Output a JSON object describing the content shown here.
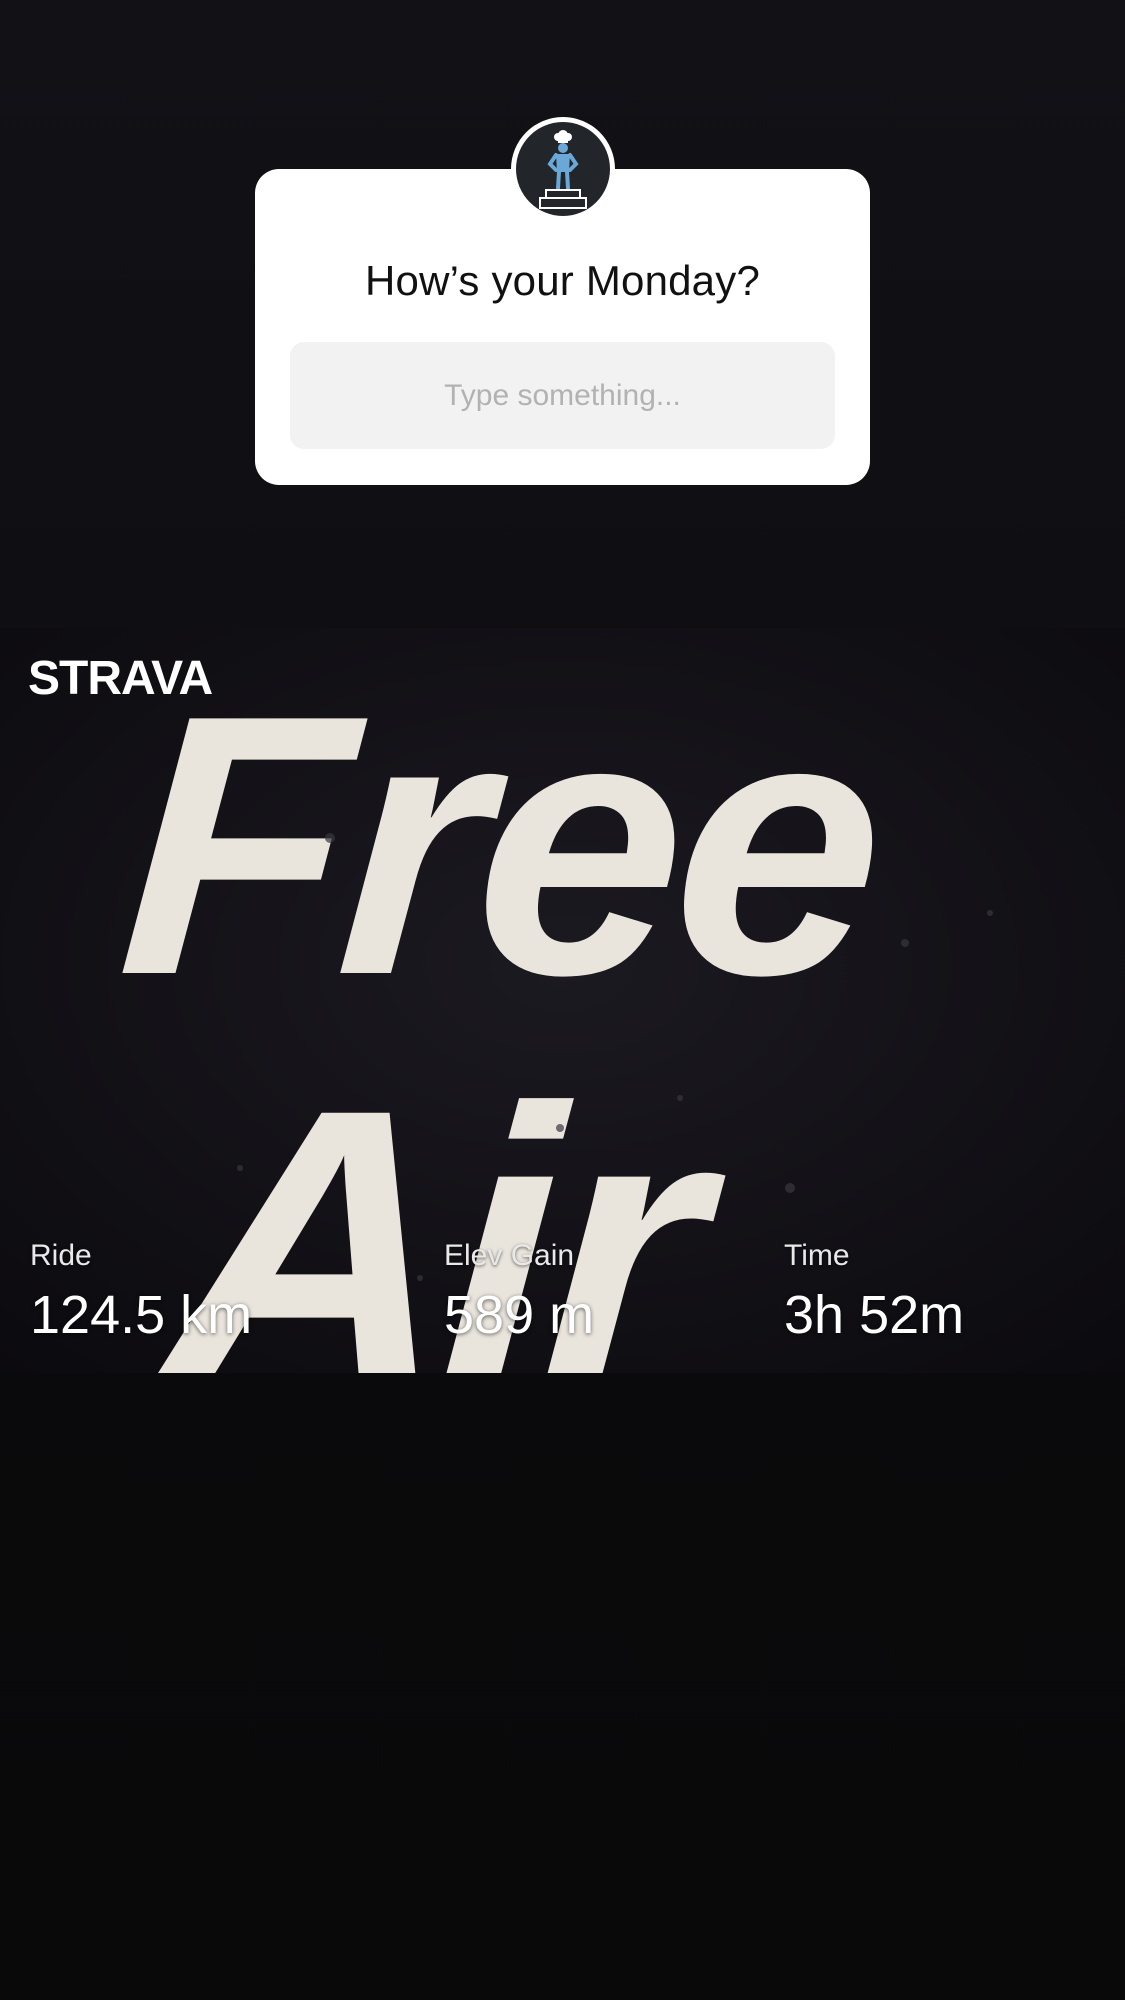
{
  "question_sticker": {
    "title": "How’s your Monday?",
    "placeholder": "Type something...",
    "avatar_icon": "chef-on-podium-icon"
  },
  "activity": {
    "brand": "STRAVA",
    "photo_text": [
      "Free",
      "Air"
    ],
    "stats": [
      {
        "label": "Ride",
        "value": "124.5 km"
      },
      {
        "label": "Elev Gain",
        "value": "589 m"
      },
      {
        "label": "Time",
        "value": "3h 52m"
      }
    ]
  },
  "colors": {
    "background": "#0b0b0d",
    "card": "#ffffff",
    "input": "#f2f2f2",
    "avatar_bg": "#22262b",
    "figure_blue": "#6aa8d8",
    "photo_letters": "#e9e4dc"
  }
}
